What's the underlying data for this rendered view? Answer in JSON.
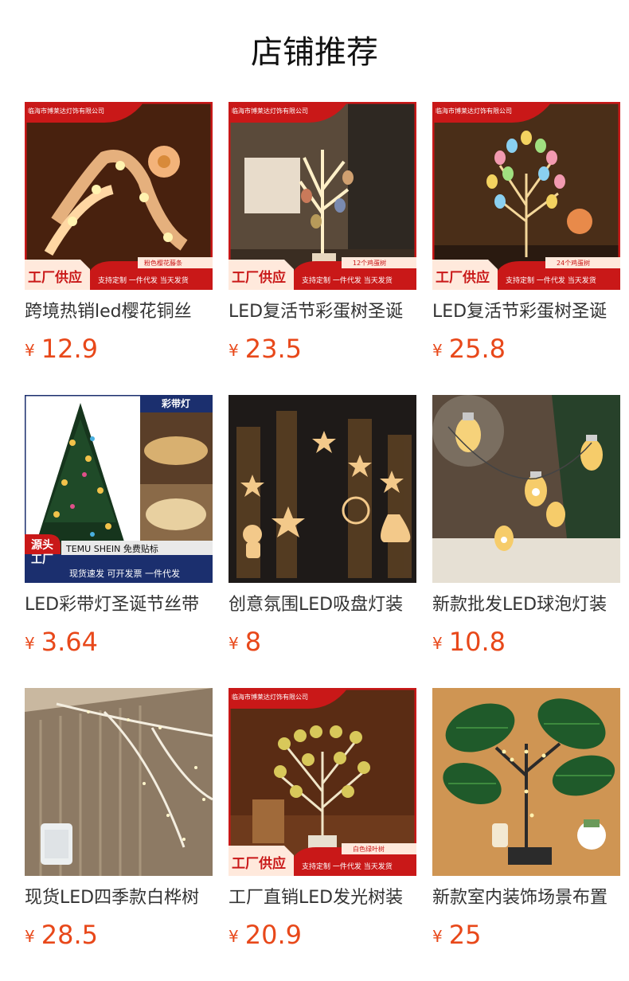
{
  "page": {
    "title": "店铺推荐"
  },
  "currency_symbol": "¥",
  "colors": {
    "price": "#e8481a",
    "banner_red": "#d41d1d"
  },
  "products": [
    {
      "name": "跨境热销led樱花铜丝",
      "price": "12.9",
      "image": {
        "company": "临海市博莱达灯饰有限公司",
        "tag": "粉色樱花藤条",
        "badge": "工厂供应",
        "strip": "支持定制 一件代发 当天发货"
      }
    },
    {
      "name": "LED复活节彩蛋树圣诞",
      "price": "23.5",
      "image": {
        "company": "临海市博莱达灯饰有限公司",
        "tag": "12个鸡蛋树",
        "badge": "工厂供应",
        "strip": "支持定制 一件代发 当天发货"
      }
    },
    {
      "name": "LED复活节彩蛋树圣诞",
      "price": "25.8",
      "image": {
        "company": "临海市博莱达灯饰有限公司",
        "tag": "24个鸡蛋树",
        "badge": "工厂供应",
        "strip": "支持定制 一件代发 当天发货"
      }
    },
    {
      "name": "LED彩带灯圣诞节丝带",
      "price": "3.64",
      "image": {
        "corner_label": "彩带灯",
        "badge_line1": "源头",
        "badge_line2": "工厂",
        "brands": "TEMU SHEIN 免费贴标",
        "strip": "现货速发 可开发票 一件代发"
      }
    },
    {
      "name": "创意氛围LED吸盘灯装",
      "price": "8",
      "image": {}
    },
    {
      "name": "新款批发LED球泡灯装",
      "price": "10.8",
      "image": {}
    },
    {
      "name": "现货LED四季款白桦树",
      "price": "28.5",
      "image": {}
    },
    {
      "name": "工厂直销LED发光树装",
      "price": "20.9",
      "image": {
        "company": "临海市博莱达灯饰有限公司",
        "tag": "白色绿叶树",
        "badge": "工厂供应",
        "strip": "支持定制 一件代发 当天发货"
      }
    },
    {
      "name": "新款室内装饰场景布置",
      "price": "25",
      "image": {}
    }
  ]
}
